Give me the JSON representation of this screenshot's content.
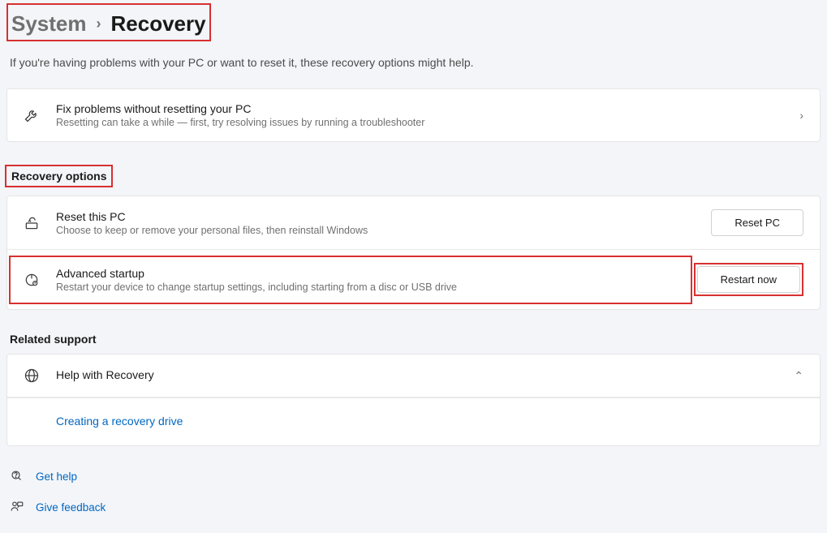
{
  "breadcrumb": {
    "parent": "System",
    "current": "Recovery"
  },
  "page_description": "If you're having problems with your PC or want to reset it, these recovery options might help.",
  "troubleshooter": {
    "title": "Fix problems without resetting your PC",
    "sub": "Resetting can take a while — first, try resolving issues by running a troubleshooter"
  },
  "recovery_options_header": "Recovery options",
  "reset_pc": {
    "title": "Reset this PC",
    "sub": "Choose to keep or remove your personal files, then reinstall Windows",
    "button": "Reset PC"
  },
  "advanced_startup": {
    "title": "Advanced startup",
    "sub": "Restart your device to change startup settings, including starting from a disc or USB drive",
    "button": "Restart now"
  },
  "related_support_header": "Related support",
  "help_recovery": {
    "title": "Help with Recovery",
    "link": "Creating a recovery drive"
  },
  "footer": {
    "get_help": "Get help",
    "give_feedback": "Give feedback"
  }
}
